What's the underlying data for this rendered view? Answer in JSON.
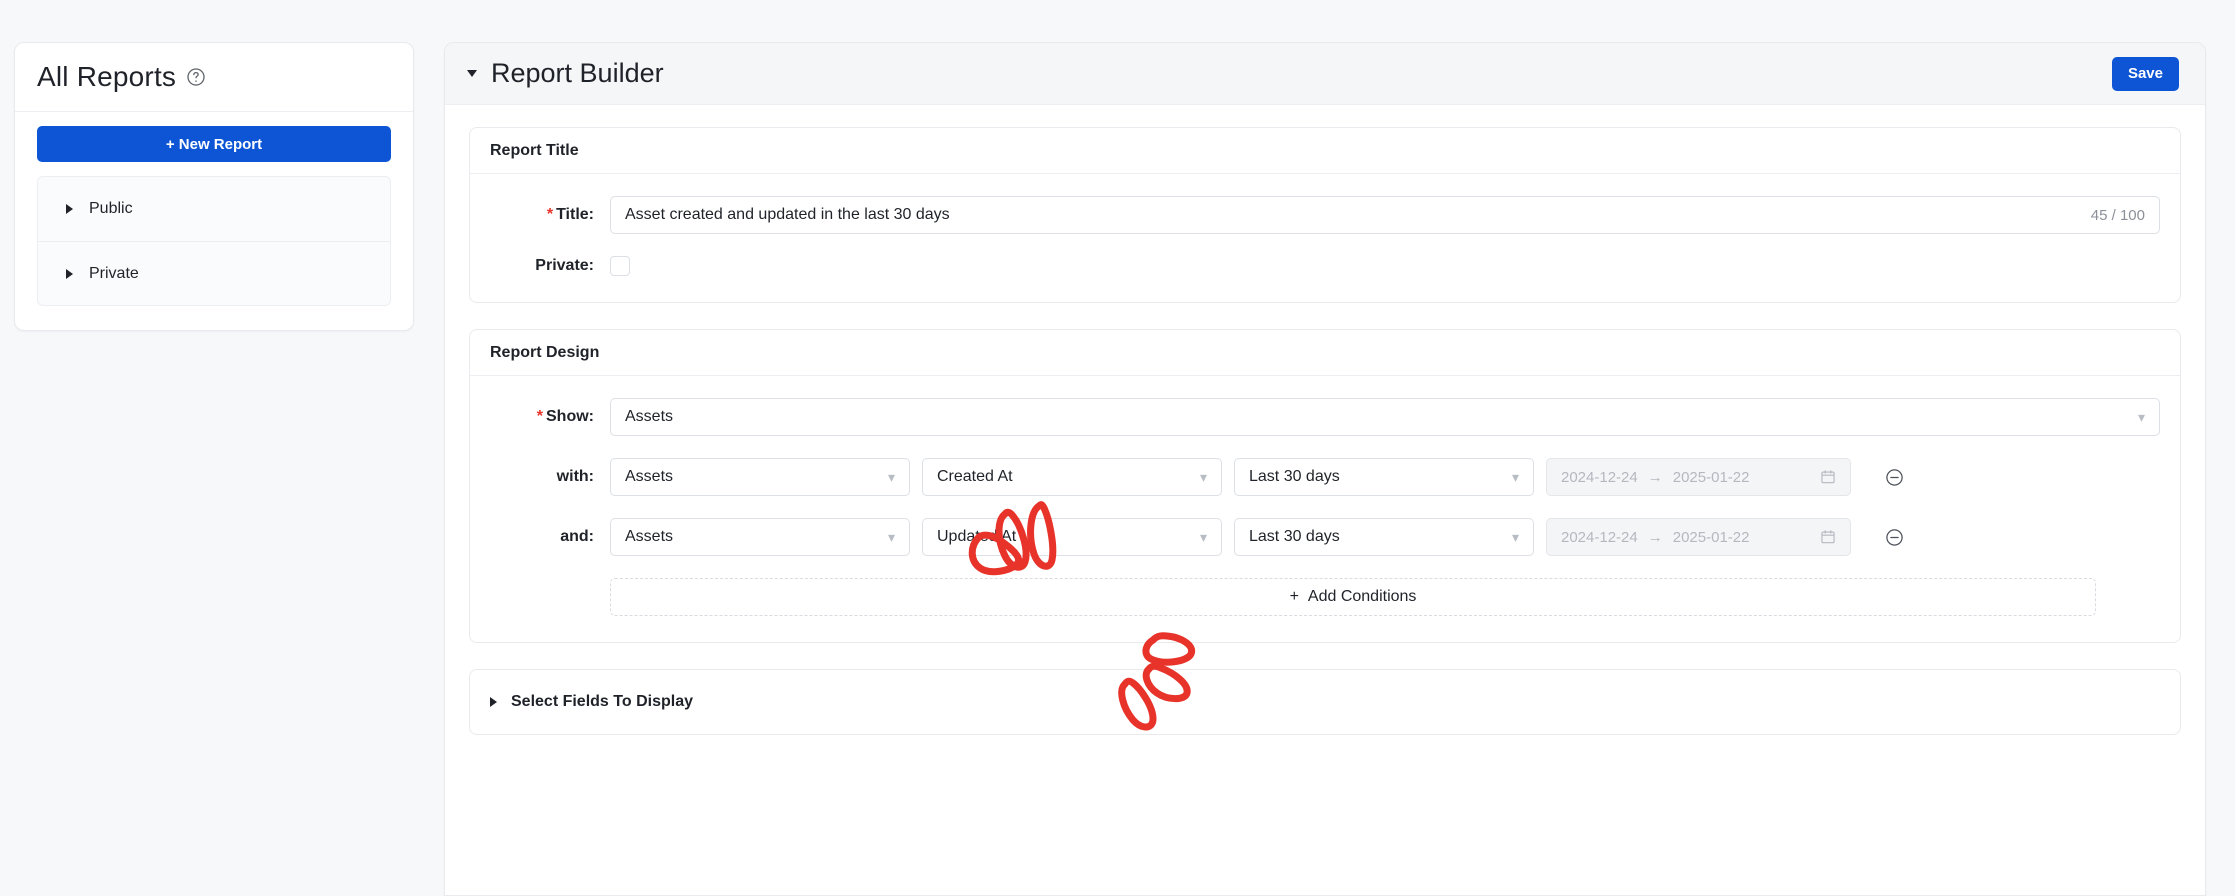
{
  "sidebar": {
    "title": "All Reports",
    "help_icon": "question-circle-icon",
    "new_report_label": "+ New Report",
    "items": [
      {
        "label": "Public",
        "icon": "caret-right-icon"
      },
      {
        "label": "Private",
        "icon": "caret-right-icon"
      }
    ]
  },
  "builder": {
    "title": "Report Builder",
    "collapse_icon": "caret-down-icon",
    "save_label": "Save"
  },
  "report_title_card": {
    "heading": "Report Title",
    "title_label": "Title",
    "title_required": "*",
    "title_value": "Asset created and updated in the last 30 days",
    "title_counter": "45 / 100",
    "private_label": "Private",
    "private_checked": false
  },
  "report_design_card": {
    "heading": "Report Design",
    "show_label": "Show",
    "show_required": "*",
    "show_value": "Assets",
    "conditions": [
      {
        "connector": "with",
        "entity": "Assets",
        "attribute": "Created At",
        "operator": "Last 30 days",
        "date_start": "2024-12-24",
        "date_arrow": "→",
        "date_end": "2025-01-22",
        "calendar_icon": "calendar-icon",
        "remove_icon": "minus-circle-icon"
      },
      {
        "connector": "and",
        "entity": "Assets",
        "attribute": "Updated At",
        "operator": "Last 30 days",
        "date_start": "2024-12-24",
        "date_arrow": "→",
        "date_end": "2025-01-22",
        "calendar_icon": "calendar-icon",
        "remove_icon": "minus-circle-icon"
      }
    ],
    "add_conditions_label": "Add Conditions",
    "add_icon": "plus-icon"
  },
  "select_fields_card": {
    "label": "Select Fields To Display",
    "expand_icon": "caret-right-icon"
  },
  "colors": {
    "accent": "#0d55d4",
    "required": "#e8332a",
    "annotation": "#e8332a",
    "page_bg": "#f7f8fa",
    "panel_bg": "#ffffff",
    "border": "#e8eaed",
    "muted_text": "#b4b8bf"
  },
  "annotations": [
    {
      "name": "scribble-over-created-at",
      "shape": "three-red-loops"
    },
    {
      "name": "scribble-over-updated-at",
      "shape": "three-red-loops"
    }
  ]
}
